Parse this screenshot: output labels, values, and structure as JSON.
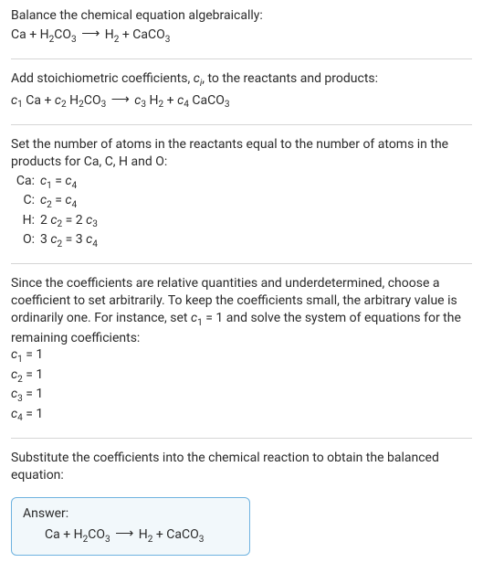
{
  "step1": {
    "intro": "Balance the chemical equation algebraically:",
    "equation": {
      "r1": "Ca",
      "plus1": " + ",
      "r2": "H",
      "r2sub": "2",
      "r3": "CO",
      "r3sub": "3",
      "arrow": "  ⟶  ",
      "p1": "H",
      "p1sub": "2",
      "plus2": " + ",
      "p2": "CaCO",
      "p2sub": "3"
    }
  },
  "step2": {
    "intro_a": "Add stoichiometric coefficients, ",
    "intro_ci": "c",
    "intro_ci_sub": "i",
    "intro_b": ", to the reactants and products:",
    "equation": {
      "c1": "c",
      "c1sub": "1",
      "sp1": " ",
      "r1": "Ca",
      "plus1": " + ",
      "c2": "c",
      "c2sub": "2",
      "sp2": " ",
      "r2a": "H",
      "r2asub": "2",
      "r2b": "CO",
      "r2bsub": "3",
      "arrow": "  ⟶  ",
      "c3": "c",
      "c3sub": "3",
      "sp3": " ",
      "p1": "H",
      "p1sub": "2",
      "plus2": " + ",
      "c4": "c",
      "c4sub": "4",
      "sp4": " ",
      "p2": "CaCO",
      "p2sub": "3"
    }
  },
  "step3": {
    "intro": "Set the number of atoms in the reactants equal to the number of atoms in the products for Ca, C, H and O:",
    "rows": [
      {
        "el": "Ca:",
        "lhs_c": "c",
        "lhs_sub": "1",
        "eq": " = ",
        "rhs_c": "c",
        "rhs_sub": "4",
        "lcoef": "",
        "rcoef": ""
      },
      {
        "el": "C:",
        "lhs_c": "c",
        "lhs_sub": "2",
        "eq": " = ",
        "rhs_c": "c",
        "rhs_sub": "4",
        "lcoef": "",
        "rcoef": ""
      },
      {
        "el": "H:",
        "lhs_c": "c",
        "lhs_sub": "2",
        "eq": " = ",
        "rhs_c": "c",
        "rhs_sub": "3",
        "lcoef": "2 ",
        "rcoef": "2 "
      },
      {
        "el": "O:",
        "lhs_c": "c",
        "lhs_sub": "2",
        "eq": " = ",
        "rhs_c": "c",
        "rhs_sub": "4",
        "lcoef": "3 ",
        "rcoef": "3 "
      }
    ]
  },
  "step4": {
    "intro_a": "Since the coefficients are relative quantities and underdetermined, choose a coefficient to set arbitrarily. To keep the coefficients small, the arbitrary value is ordinarily one. For instance, set ",
    "set_c": "c",
    "set_sub": "1",
    "set_eq": " = 1",
    "intro_b": " and solve the system of equations for the remaining coefficients:",
    "sol": [
      {
        "c": "c",
        "sub": "1",
        "val": " = 1"
      },
      {
        "c": "c",
        "sub": "2",
        "val": " = 1"
      },
      {
        "c": "c",
        "sub": "3",
        "val": " = 1"
      },
      {
        "c": "c",
        "sub": "4",
        "val": " = 1"
      }
    ]
  },
  "step5": {
    "intro": "Substitute the coefficients into the chemical reaction to obtain the balanced equation:"
  },
  "answer": {
    "title": "Answer:",
    "equation": {
      "r1": "Ca",
      "plus1": " + ",
      "r2": "H",
      "r2sub": "2",
      "r3": "CO",
      "r3sub": "3",
      "arrow": "  ⟶  ",
      "p1": "H",
      "p1sub": "2",
      "plus2": " + ",
      "p2": "CaCO",
      "p2sub": "3"
    }
  }
}
